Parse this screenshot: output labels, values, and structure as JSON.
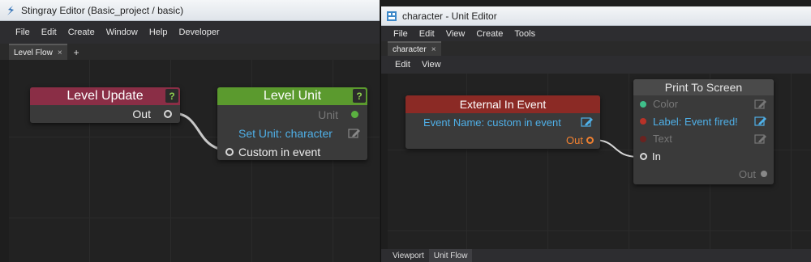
{
  "left_window": {
    "title": "Stingray Editor (Basic_project / basic)",
    "menu": [
      "File",
      "Edit",
      "Create",
      "Window",
      "Help",
      "Developer"
    ],
    "tab": "Level Flow",
    "nodes": {
      "level_update": {
        "title": "Level Update",
        "help": "?",
        "out": "Out",
        "color": "#8a2e46"
      },
      "level_unit": {
        "title": "Level Unit",
        "help": "?",
        "unit": "Unit",
        "set_unit": "Set Unit: character",
        "custom_event": "Custom in event",
        "color": "#5b9a2e"
      }
    }
  },
  "right_window": {
    "title": "character - Unit Editor",
    "menu": [
      "File",
      "Edit",
      "View",
      "Create",
      "Tools"
    ],
    "tab": "character",
    "submenu": [
      "Edit",
      "View"
    ],
    "nodes": {
      "external_in_event": {
        "title": "External In Event",
        "event_name": "Event Name: custom in event",
        "out": "Out",
        "color": "#8b2a25"
      },
      "print_to_screen": {
        "title": "Print To Screen",
        "color_label": "Color",
        "label": "Label: Event fired!",
        "text": "Text",
        "in": "In",
        "out": "Out"
      }
    },
    "bottom_tabs": [
      "Viewport",
      "Unit Flow"
    ]
  },
  "colors": {
    "accent_blue": "#4fb0e8",
    "pin_green": "#5ab040",
    "pin_red": "#b83228",
    "orange": "#f08030"
  },
  "icons": {
    "close_tab": "×",
    "add_tab": "+",
    "edit": "pencil-in-box-icon"
  }
}
